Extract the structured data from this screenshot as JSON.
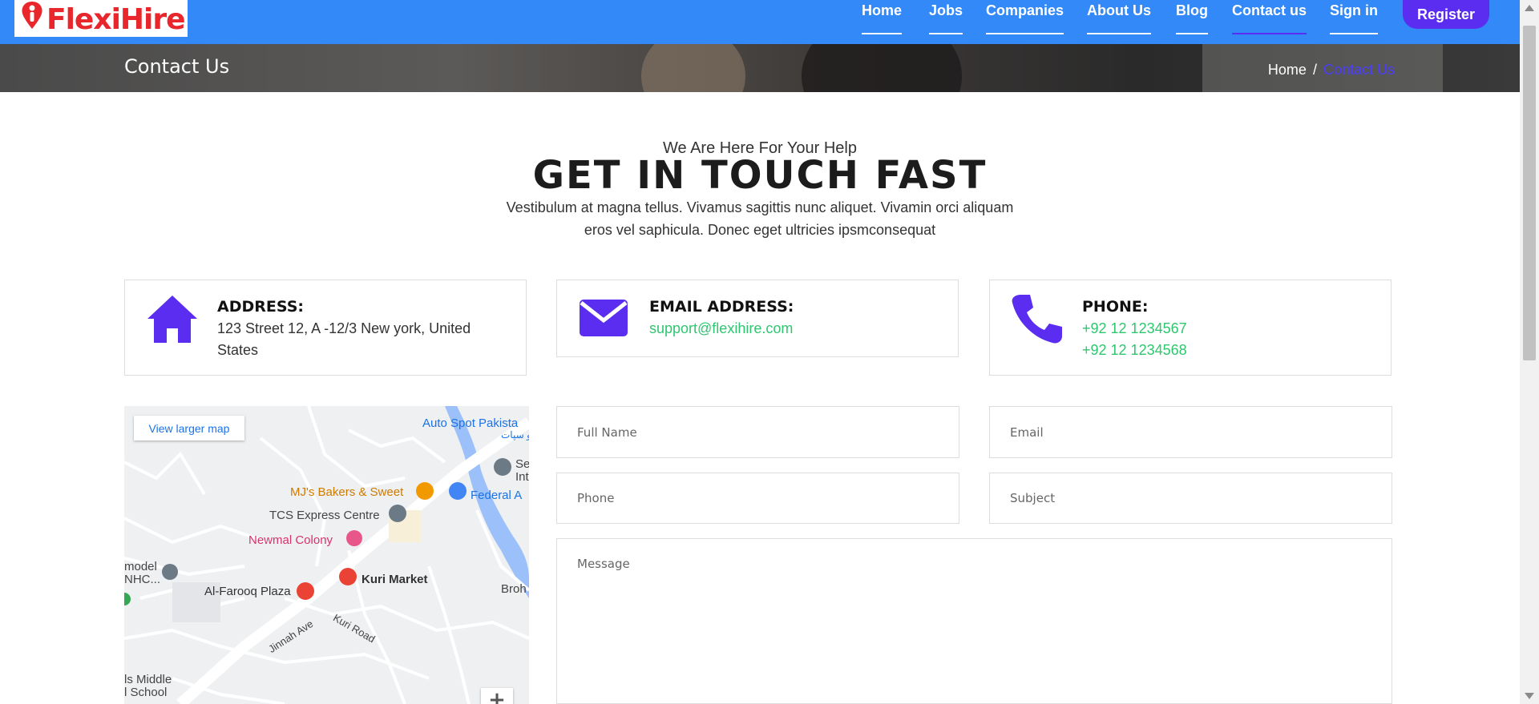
{
  "brand": {
    "name": "FlexiHire",
    "primary_color": "#3489f8",
    "accent_color": "#5a2df0",
    "logo_color": "#e8262b"
  },
  "nav": {
    "items": [
      {
        "label": "Home"
      },
      {
        "label": "Jobs"
      },
      {
        "label": "Companies"
      },
      {
        "label": "About Us"
      },
      {
        "label": "Blog"
      },
      {
        "label": "Contact us",
        "active": true
      },
      {
        "label": "Sign in"
      }
    ],
    "register_label": "Register"
  },
  "banner": {
    "title": "Contact Us",
    "breadcrumb": {
      "home": "Home",
      "separator": "/",
      "current": "Contact Us"
    }
  },
  "intro": {
    "subheading": "We Are Here For Your Help",
    "heading": "GET IN TOUCH FAST",
    "description": "Vestibulum at magna tellus. Vivamus sagittis nunc aliquet. Vivamin orci aliquam eros vel saphicula. Donec eget ultricies ipsmconsequat"
  },
  "cards": {
    "address": {
      "icon": "home-icon",
      "title": "ADDRESS:",
      "line1": "123 Street 12, A -12/3 New york, United",
      "line2": "States"
    },
    "email": {
      "icon": "envelope-icon",
      "title": "EMAIL ADDRESS:",
      "value": "support@flexihire.com"
    },
    "phone": {
      "icon": "phone-icon",
      "title": "PHONE:",
      "phone1": "+92 12 1234567",
      "phone2": "+92 12 1234568"
    }
  },
  "map": {
    "view_larger": "View larger map",
    "zoom_in": "+",
    "labels": {
      "auto_spot": "Auto Spot Pakista",
      "auto_spot_urdu": "و سپات",
      "se": "Se",
      "int": "Int",
      "federal": "Federal A",
      "mjs": "MJ's Bakers & Sweet",
      "tcs": "TCS Express Centre",
      "newmal": "Newmal Colony",
      "model": "model",
      "nhc": "NHC...",
      "alfarooq": "Al-Farooq Plaza",
      "kuri_market": "Kuri Market",
      "broh": "Broh",
      "jinnah": "Jinnah Ave",
      "kuri_road": "Kuri Road",
      "middle": "ls Middle",
      "school": "l School"
    }
  },
  "form": {
    "full_name_placeholder": "Full Name",
    "email_placeholder": "Email",
    "phone_placeholder": "Phone",
    "subject_placeholder": "Subject",
    "message_placeholder": "Message"
  }
}
